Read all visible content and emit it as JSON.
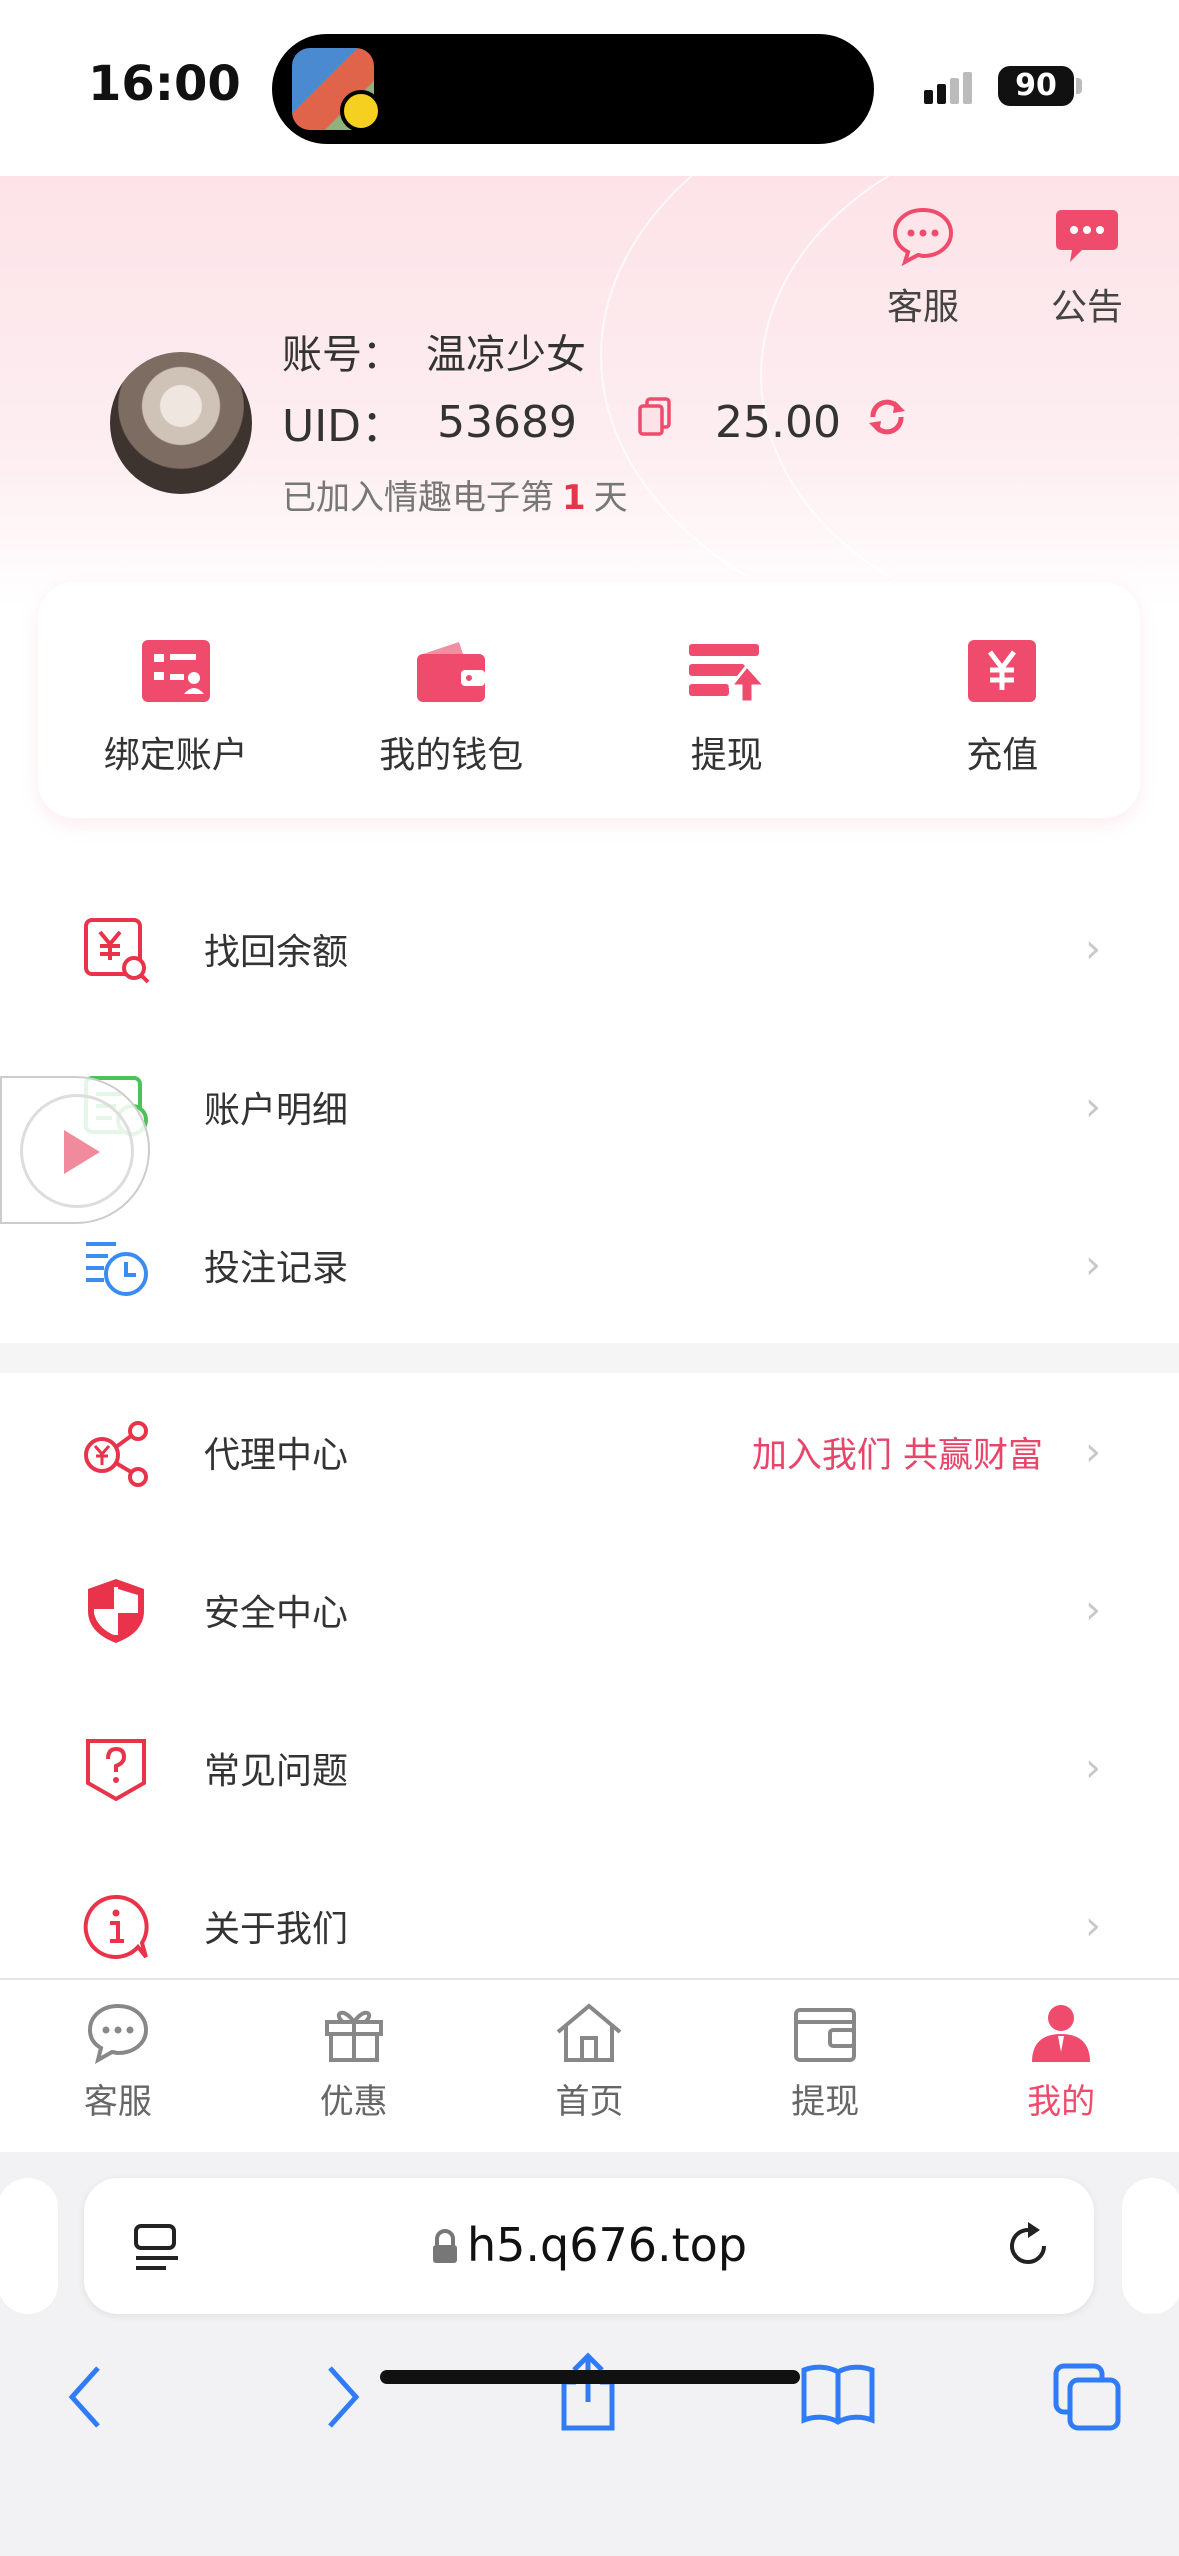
{
  "status_bar": {
    "time": "16:00",
    "battery": "90"
  },
  "header": {
    "service_label": "客服",
    "notice_label": "公告",
    "account_label": "账号：",
    "account_name": "温凉少女",
    "uid_label": "UID：",
    "uid_value": "53689",
    "balance": "25.00",
    "joined_prefix": "已加入情趣电子第",
    "joined_days": "1",
    "joined_suffix": "天"
  },
  "quick_actions": [
    {
      "label": "绑定账户",
      "icon": "bind-account-icon"
    },
    {
      "label": "我的钱包",
      "icon": "wallet-icon"
    },
    {
      "label": "提现",
      "icon": "withdraw-icon"
    },
    {
      "label": "充值",
      "icon": "recharge-icon"
    }
  ],
  "menu_group_1": [
    {
      "label": "找回余额",
      "icon": "recover-balance-icon"
    },
    {
      "label": "账户明细",
      "icon": "account-details-icon"
    },
    {
      "label": "投注记录",
      "icon": "bet-record-icon"
    }
  ],
  "menu_group_2": [
    {
      "label": "代理中心",
      "extra": "加入我们 共赢财富",
      "icon": "agent-share-icon"
    },
    {
      "label": "安全中心",
      "icon": "shield-icon"
    },
    {
      "label": "常见问题",
      "icon": "question-icon"
    },
    {
      "label": "关于我们",
      "icon": "info-icon"
    }
  ],
  "tabbar": [
    {
      "label": "客服",
      "icon": "chat-icon"
    },
    {
      "label": "优惠",
      "icon": "gift-icon"
    },
    {
      "label": "首页",
      "icon": "home-icon"
    },
    {
      "label": "提现",
      "icon": "wallet-icon"
    },
    {
      "label": "我的",
      "icon": "user-icon",
      "active": true
    }
  ],
  "browser": {
    "url": "h5.q676.top"
  },
  "colors": {
    "accent": "#ef4b6c",
    "accent_light": "#fde3e8"
  }
}
